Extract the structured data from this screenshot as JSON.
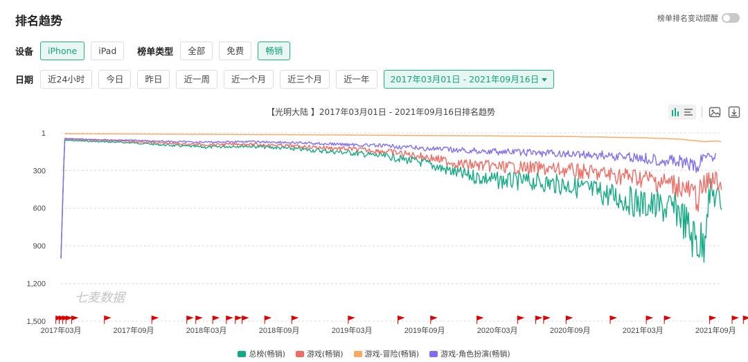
{
  "page": {
    "title": "排名趋势",
    "alert_toggle_label": "榜单排名变动提醒",
    "alert_toggle_on": false
  },
  "filters": {
    "device_label": "设备",
    "devices": [
      {
        "label": "iPhone",
        "active": true
      },
      {
        "label": "iPad",
        "active": false
      }
    ],
    "chart_type_label": "榜单类型",
    "chart_types": [
      {
        "label": "全部",
        "active": false
      },
      {
        "label": "免费",
        "active": false
      },
      {
        "label": "畅销",
        "active": true
      }
    ],
    "date_label": "日期",
    "dates": [
      "近24小时",
      "今日",
      "昨日",
      "近一周",
      "近一个月",
      "近三个月",
      "近一年"
    ],
    "date_range": "2017年03月01日 - 2021年09月16日"
  },
  "chart_data": {
    "type": "line",
    "title": "【光明大陆 】2017年03月01日 - 2021年09月16日排名趋势",
    "y_inverted": true,
    "ylim": [
      1,
      1500
    ],
    "yticks": [
      "1",
      "300",
      "600",
      "900",
      "1,200",
      "1,500"
    ],
    "ytick_values": [
      1,
      300,
      600,
      900,
      1200,
      1500
    ],
    "xticks": [
      "2017年03月",
      "2017年09月",
      "2018年03月",
      "2018年09月",
      "2019年03月",
      "2019年09月",
      "2020年03月",
      "2020年09月",
      "2021年03月",
      "2021年09月"
    ],
    "x_start": "2017-03",
    "x_end": "2021-09-16",
    "grid": true,
    "legend_position": "bottom",
    "watermark": "七麦数据",
    "series": [
      {
        "name": "总榜(畅销)",
        "color": "#14aa85",
        "points": [
          [
            0.0,
            1000
          ],
          [
            0.3,
            60
          ],
          [
            3,
            70
          ],
          [
            6,
            80
          ],
          [
            9,
            100
          ],
          [
            12,
            115
          ],
          [
            15,
            105
          ],
          [
            18,
            120
          ],
          [
            21,
            140
          ],
          [
            24,
            160
          ],
          [
            27,
            190
          ],
          [
            30,
            240
          ],
          [
            33,
            330
          ],
          [
            36,
            380
          ],
          [
            39,
            390
          ],
          [
            42,
            420
          ],
          [
            45,
            490
          ],
          [
            48,
            570
          ],
          [
            51,
            620
          ],
          [
            52,
            820
          ],
          [
            53,
            900
          ],
          [
            53.3,
            580
          ],
          [
            53.6,
            470
          ],
          [
            54.5,
            560
          ]
        ]
      },
      {
        "name": "游戏(畅销)",
        "color": "#f06b62",
        "points": [
          [
            0.0,
            1000
          ],
          [
            0.3,
            50
          ],
          [
            3,
            60
          ],
          [
            6,
            70
          ],
          [
            9,
            85
          ],
          [
            12,
            95
          ],
          [
            15,
            90
          ],
          [
            18,
            100
          ],
          [
            21,
            115
          ],
          [
            24,
            130
          ],
          [
            27,
            150
          ],
          [
            30,
            190
          ],
          [
            33,
            250
          ],
          [
            36,
            270
          ],
          [
            39,
            280
          ],
          [
            42,
            300
          ],
          [
            45,
            330
          ],
          [
            48,
            360
          ],
          [
            51,
            420
          ],
          [
            52.5,
            520
          ],
          [
            53,
            440
          ],
          [
            53.6,
            370
          ],
          [
            54.5,
            400
          ]
        ]
      },
      {
        "name": "游戏-冒险(畅销)",
        "color": "#f7a861",
        "points": [
          [
            0.3,
            8
          ],
          [
            6,
            10
          ],
          [
            12,
            12
          ],
          [
            18,
            15
          ],
          [
            24,
            18
          ],
          [
            30,
            22
          ],
          [
            36,
            25
          ],
          [
            42,
            30
          ],
          [
            48,
            40
          ],
          [
            51,
            50
          ],
          [
            53,
            70
          ],
          [
            54,
            65
          ],
          [
            54.5,
            70
          ]
        ]
      },
      {
        "name": "游戏-角色扮演(畅销)",
        "color": "#7f6ff0",
        "points": [
          [
            0.0,
            1000
          ],
          [
            0.3,
            45
          ],
          [
            3,
            55
          ],
          [
            6,
            60
          ],
          [
            9,
            70
          ],
          [
            12,
            75
          ],
          [
            15,
            70
          ],
          [
            18,
            75
          ],
          [
            21,
            85
          ],
          [
            24,
            95
          ],
          [
            27,
            105
          ],
          [
            30,
            125
          ],
          [
            33,
            140
          ],
          [
            36,
            150
          ],
          [
            39,
            160
          ],
          [
            42,
            170
          ],
          [
            45,
            180
          ],
          [
            48,
            200
          ],
          [
            51,
            230
          ],
          [
            52.5,
            280
          ],
          [
            53,
            180
          ],
          [
            54,
            185
          ]
        ]
      }
    ],
    "markers": [
      0.1,
      0.4,
      0.7,
      1.0,
      1.5,
      4.4,
      8.6,
      11.7,
      12.5,
      14.0,
      15.2,
      16.0,
      16.6,
      18.6,
      21.0,
      26.0,
      30.4,
      33.3,
      37.4,
      41.0,
      42.6,
      43.3,
      45.3,
      49.2,
      52.4,
      54.0,
      58.0,
      60.0,
      61.0,
      62.0,
      63.0
    ]
  },
  "legend": [
    "总榜(畅销)",
    "游戏(畅销)",
    "游戏-冒险(畅销)",
    "游戏-角色扮演(畅销)"
  ]
}
